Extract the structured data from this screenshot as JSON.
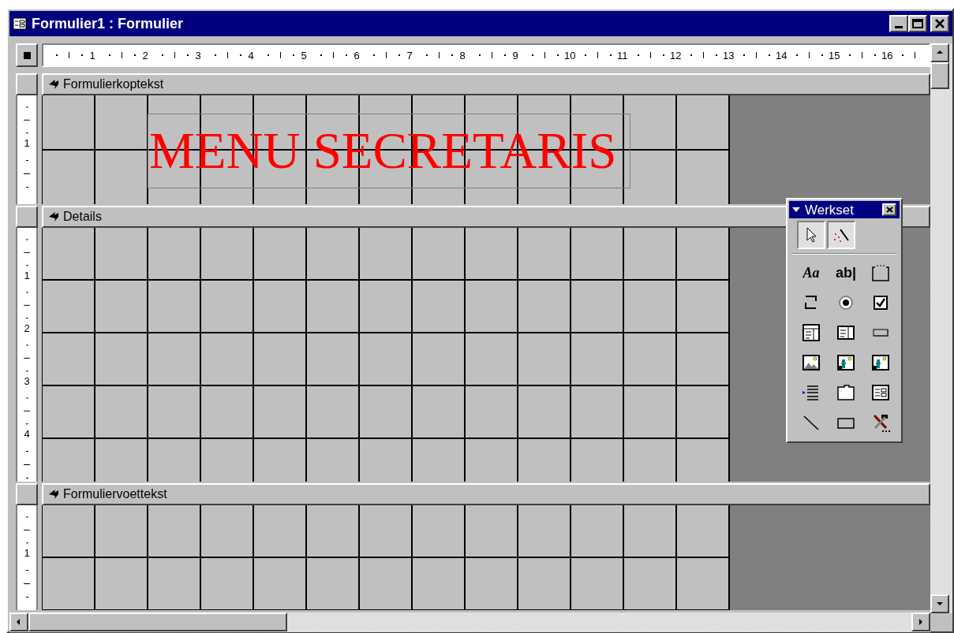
{
  "window": {
    "title": "Formulier1 : Formulier"
  },
  "horizontal_ruler": {
    "marks": [
      "1",
      "2",
      "3",
      "4",
      "5",
      "6",
      "7",
      "8",
      "9",
      "10",
      "11",
      "12",
      "13",
      "14",
      "15",
      "16"
    ]
  },
  "sections": [
    {
      "kind": "header",
      "title": "Formulierkoptekst",
      "ruler_marks": [
        "1"
      ],
      "controls": [
        {
          "kind": "label",
          "text": "MENU SECRETARIS"
        }
      ]
    },
    {
      "kind": "detail",
      "title": "Details",
      "ruler_marks": [
        "1",
        "2",
        "3",
        "4"
      ]
    },
    {
      "kind": "footer",
      "title": "Formuliervoettekst",
      "ruler_marks": [
        "1"
      ]
    }
  ],
  "toolbox": {
    "title": "Werkset",
    "tools": [
      {
        "kind": "pointer",
        "pressed": true
      },
      {
        "kind": "wizard",
        "pressed": true
      },
      {
        "kind": "label",
        "text": "Aa",
        "pressed": false
      },
      {
        "kind": "textbox",
        "text": "ab|",
        "pressed": false
      },
      {
        "kind": "option-group",
        "pressed": false
      },
      {
        "kind": "toggle",
        "pressed": false
      },
      {
        "kind": "radio",
        "pressed": false
      },
      {
        "kind": "checkbox",
        "pressed": false
      },
      {
        "kind": "combo",
        "pressed": false
      },
      {
        "kind": "listbox",
        "pressed": false
      },
      {
        "kind": "button",
        "pressed": false
      },
      {
        "kind": "image",
        "pressed": false
      },
      {
        "kind": "unbound-frame",
        "pressed": false
      },
      {
        "kind": "bound-frame",
        "pressed": false
      },
      {
        "kind": "page-break",
        "pressed": false
      },
      {
        "kind": "tab",
        "pressed": false
      },
      {
        "kind": "subform",
        "pressed": false
      },
      {
        "kind": "line",
        "pressed": false
      },
      {
        "kind": "rectangle",
        "pressed": false
      },
      {
        "kind": "more-tools",
        "pressed": false
      }
    ]
  }
}
